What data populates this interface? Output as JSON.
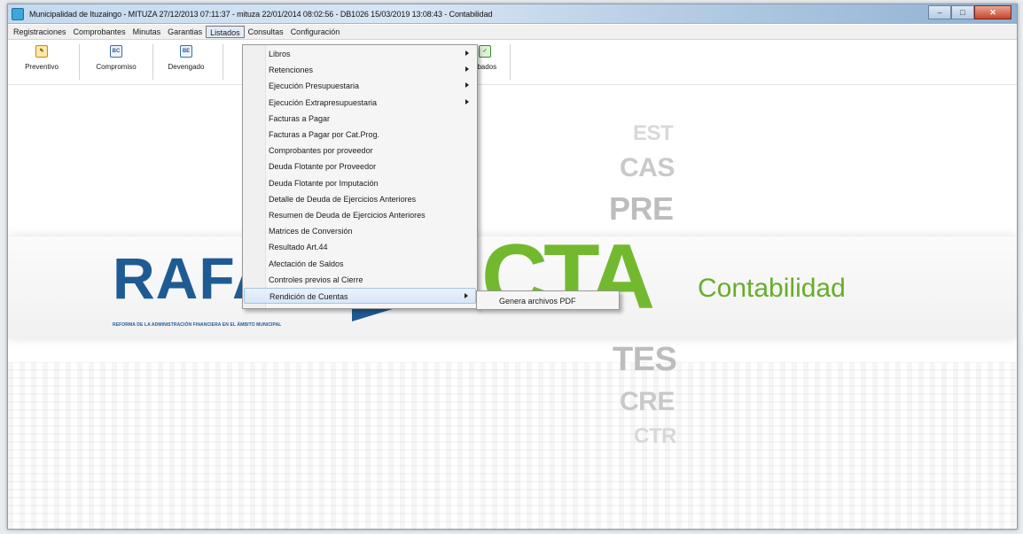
{
  "window": {
    "title": "Municipalidad de Ituzaingo - MITUZA 27/12/2013 07:11:37 - mituza 22/01/2014 08:02:56 - DB1026 15/03/2019 13:08:43 - Contabilidad"
  },
  "menubar": {
    "items": [
      "Registraciones",
      "Comprobantes",
      "Minutas",
      "Garantias",
      "Listados",
      "Consultas",
      "Configuración"
    ],
    "active_index": 4
  },
  "toolbar": {
    "buttons": [
      {
        "label": "Preventivo",
        "icon": "pencil-document-icon"
      },
      {
        "label": "Compromiso",
        "icon": "document-bc-icon"
      },
      {
        "label": "Devengado",
        "icon": "document-be-icon"
      },
      {
        "label": "obados",
        "icon": "approved-check-icon"
      }
    ]
  },
  "listados_menu": {
    "items": [
      {
        "label": "Libros",
        "submenu": true
      },
      {
        "label": "Retenciones",
        "submenu": true
      },
      {
        "label": "Ejecución Presupuestaria",
        "submenu": true
      },
      {
        "label": "Ejecución Extrapresupuestaria",
        "submenu": true
      },
      {
        "label": "Facturas a Pagar",
        "submenu": false
      },
      {
        "label": "Facturas a Pagar por Cat.Prog.",
        "submenu": false
      },
      {
        "label": "Comprobantes por proveedor",
        "submenu": false
      },
      {
        "label": "Deuda Flotante por Proveedor",
        "submenu": false
      },
      {
        "label": "Deuda Flotante por Imputación",
        "submenu": false
      },
      {
        "label": "Detalle de Deuda de Ejercicios Anteriores",
        "submenu": false
      },
      {
        "label": "Resumen de Deuda de Ejercicios Anteriores",
        "submenu": false
      },
      {
        "label": "Matrices de Conversión",
        "submenu": false
      },
      {
        "label": "Resultado Art.44",
        "submenu": false
      },
      {
        "label": "Afectación de Saldos",
        "submenu": false
      },
      {
        "label": "Controles previos al Cierre",
        "submenu": false
      },
      {
        "label": "Rendición de Cuentas",
        "submenu": true
      }
    ],
    "highlighted_index": 15
  },
  "rendicion_submenu": {
    "items": [
      "Genera archivos PDF"
    ]
  },
  "background": {
    "modules_top": [
      "EST",
      "CAS",
      "PRE"
    ],
    "modules_bottom": [
      "TES",
      "CRE",
      "CTR"
    ],
    "brand": "RAFAM",
    "brand_subtitle": "REFORMA DE LA ADMINISTRACIÓN FINANCIERA EN EL ÁMBITO MUNICIPAL",
    "module_code": "CTA",
    "module_name": "Contabilidad",
    "brand_color": "#1f5b93",
    "accent_color": "#73b92f"
  }
}
